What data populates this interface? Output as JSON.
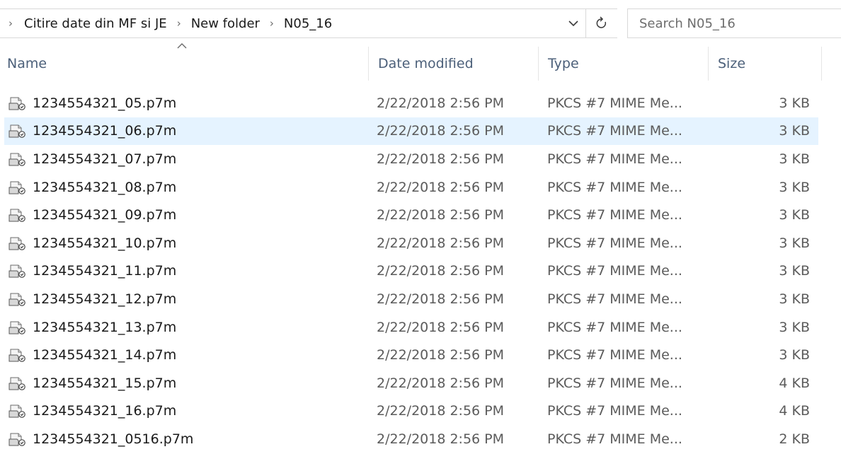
{
  "breadcrumb": {
    "items": [
      "Citire date din MF si JE",
      "New folder",
      "N05_16"
    ]
  },
  "search": {
    "placeholder": "Search N05_16"
  },
  "columns": {
    "name": "Name",
    "date": "Date modified",
    "type": "Type",
    "size": "Size"
  },
  "files": [
    {
      "name": "1234554321_05.p7m",
      "date": "2/22/2018 2:56 PM",
      "type": "PKCS #7 MIME Me...",
      "size": "3 KB"
    },
    {
      "name": "1234554321_06.p7m",
      "date": "2/22/2018 2:56 PM",
      "type": "PKCS #7 MIME Me...",
      "size": "3 KB",
      "selected": true
    },
    {
      "name": "1234554321_07.p7m",
      "date": "2/22/2018 2:56 PM",
      "type": "PKCS #7 MIME Me...",
      "size": "3 KB"
    },
    {
      "name": "1234554321_08.p7m",
      "date": "2/22/2018 2:56 PM",
      "type": "PKCS #7 MIME Me...",
      "size": "3 KB"
    },
    {
      "name": "1234554321_09.p7m",
      "date": "2/22/2018 2:56 PM",
      "type": "PKCS #7 MIME Me...",
      "size": "3 KB"
    },
    {
      "name": "1234554321_10.p7m",
      "date": "2/22/2018 2:56 PM",
      "type": "PKCS #7 MIME Me...",
      "size": "3 KB"
    },
    {
      "name": "1234554321_11.p7m",
      "date": "2/22/2018 2:56 PM",
      "type": "PKCS #7 MIME Me...",
      "size": "3 KB"
    },
    {
      "name": "1234554321_12.p7m",
      "date": "2/22/2018 2:56 PM",
      "type": "PKCS #7 MIME Me...",
      "size": "3 KB"
    },
    {
      "name": "1234554321_13.p7m",
      "date": "2/22/2018 2:56 PM",
      "type": "PKCS #7 MIME Me...",
      "size": "3 KB"
    },
    {
      "name": "1234554321_14.p7m",
      "date": "2/22/2018 2:56 PM",
      "type": "PKCS #7 MIME Me...",
      "size": "3 KB"
    },
    {
      "name": "1234554321_15.p7m",
      "date": "2/22/2018 2:56 PM",
      "type": "PKCS #7 MIME Me...",
      "size": "4 KB"
    },
    {
      "name": "1234554321_16.p7m",
      "date": "2/22/2018 2:56 PM",
      "type": "PKCS #7 MIME Me...",
      "size": "4 KB"
    },
    {
      "name": "1234554321_0516.p7m",
      "date": "2/22/2018 2:56 PM",
      "type": "PKCS #7 MIME Me...",
      "size": "2 KB"
    }
  ],
  "icons": {
    "file": "certificate-file-icon",
    "refresh": "refresh-icon",
    "dropdown": "chevron-down-icon",
    "crumb_sep": "chevron-right-icon",
    "sort": "sort-ascending-caret-icon"
  },
  "colors": {
    "selected_row": "#e5f3ff",
    "header_text": "#4c607a"
  }
}
